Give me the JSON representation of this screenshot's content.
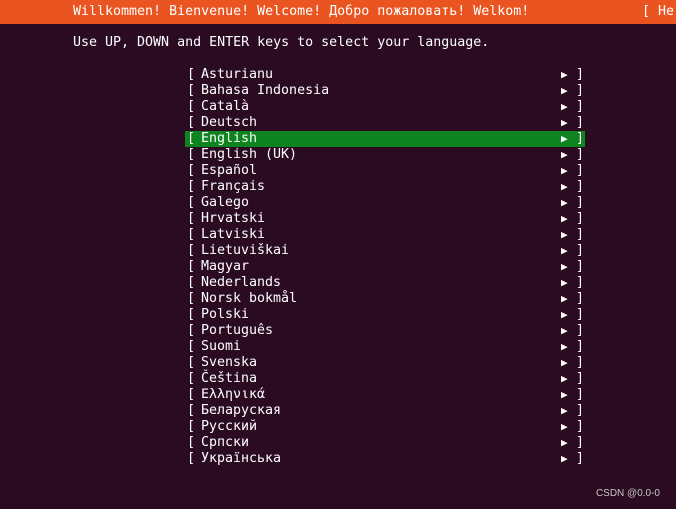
{
  "header": {
    "welcome_text": "Willkommen! Bienvenue! Welcome! Добро пожаловать! Welkom!",
    "help_text": "[ He",
    "background_color": "#e95420"
  },
  "instructions": "Use UP, DOWN and ENTER keys to select your language.",
  "languages": {
    "open_bracket": "[",
    "close_bracket": "]",
    "arrow": "▶",
    "selected_color": "#0e8420",
    "selected": "English",
    "items": [
      "Asturianu",
      "Bahasa Indonesia",
      "Català",
      "Deutsch",
      "English",
      "English (UK)",
      "Español",
      "Français",
      "Galego",
      "Hrvatski",
      "Latviski",
      "Lietuviškai",
      "Magyar",
      "Nederlands",
      "Norsk bokmål",
      "Polski",
      "Português",
      "Suomi",
      "Svenska",
      "Čeština",
      "Ελληνικά",
      "Беларуская",
      "Русский",
      "Српски",
      "Українська"
    ]
  },
  "watermark": "CSDN @0.0-0"
}
